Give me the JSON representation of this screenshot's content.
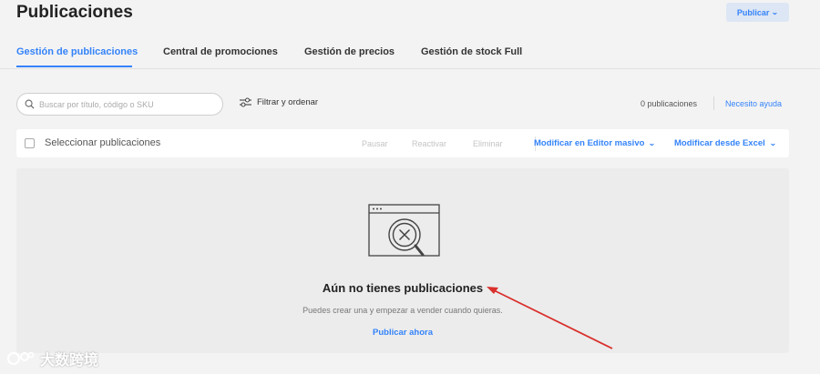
{
  "header": {
    "title": "Publicaciones",
    "publish_button": "Publicar"
  },
  "tabs": [
    {
      "label": "Gestión de publicaciones",
      "active": true
    },
    {
      "label": "Central de promociones",
      "active": false
    },
    {
      "label": "Gestión de precios",
      "active": false
    },
    {
      "label": "Gestión de stock Full",
      "active": false
    }
  ],
  "search": {
    "placeholder": "Buscar por título, código o SKU",
    "icon": "search-icon"
  },
  "filter": {
    "label": "Filtrar y ordenar",
    "icon": "sliders-icon"
  },
  "summary": {
    "count_text": "0 publicaciones",
    "help_link": "Necesito ayuda"
  },
  "toolbar": {
    "select_label": "Seleccionar publicaciones",
    "actions": [
      "Pausar",
      "Reactivar",
      "Eliminar"
    ],
    "modify_editor": "Modificar en Editor masivo",
    "modify_excel": "Modificar desde Excel"
  },
  "empty_state": {
    "title": "Aún no tienes publicaciones",
    "description": "Puedes crear una y empezar a vender cuando quieras.",
    "link": "Publicar ahora"
  },
  "watermark": {
    "text": "大数跨境"
  },
  "colors": {
    "accent": "#3483fa",
    "annotation_arrow": "#d9302c",
    "background": "#f3f3f3"
  }
}
